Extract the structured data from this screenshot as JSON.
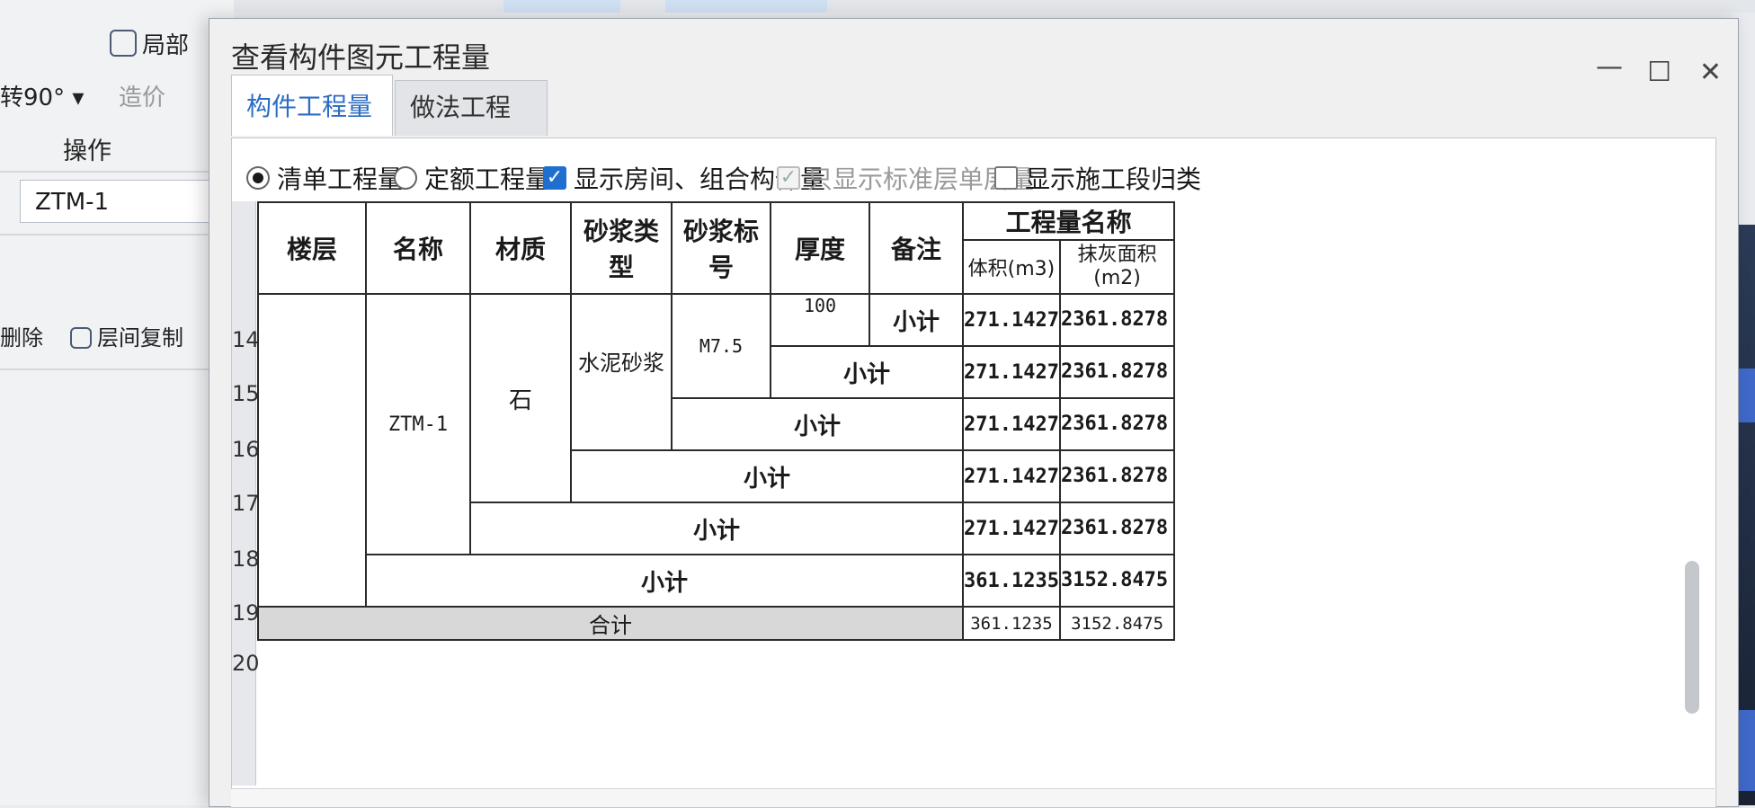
{
  "background": {
    "row1": {
      "icon": "cube-icon",
      "label": "局部"
    },
    "row2": {
      "left": "转90°",
      "right": "造价"
    },
    "section": "操作",
    "input_value": "ZTM-1",
    "delete": "删除",
    "copy": "层间复制"
  },
  "dialog": {
    "title": "查看构件图元工程量",
    "tabs": [
      "构件工程量",
      "做法工程量"
    ],
    "options": {
      "radio1": "清单工程量",
      "radio2": "定额工程量",
      "check1": "显示房间、组合构件量",
      "check2": "只显示标准层单层量",
      "check3": "显示施工段归类"
    },
    "table": {
      "headers": {
        "floor": "楼层",
        "name": "名称",
        "material": "材质",
        "mortar_type": "砂浆类型",
        "mortar_grade": "砂浆标号",
        "thickness": "厚度",
        "remark": "备注",
        "group": "工程量名称",
        "volume": "体积(m3)",
        "area": "抹灰面积(m2)"
      },
      "row_numbers": [
        "14",
        "15",
        "16",
        "17",
        "18",
        "19",
        "20"
      ],
      "values": {
        "name": "ZTM-1",
        "material": "石",
        "mortar_type": "水泥砂浆",
        "mortar_grade": "M7.5",
        "thickness": "100",
        "subtotal": "小计",
        "total": "合计"
      },
      "rows": [
        {
          "volume": "271.1427",
          "area": "2361.8278"
        },
        {
          "volume": "271.1427",
          "area": "2361.8278"
        },
        {
          "volume": "271.1427",
          "area": "2361.8278"
        },
        {
          "volume": "271.1427",
          "area": "2361.8278"
        },
        {
          "volume": "271.1427",
          "area": "2361.8278"
        },
        {
          "volume": "361.1235",
          "area": "3152.8475"
        },
        {
          "volume": "361.1235",
          "area": "3152.8475"
        }
      ]
    }
  }
}
